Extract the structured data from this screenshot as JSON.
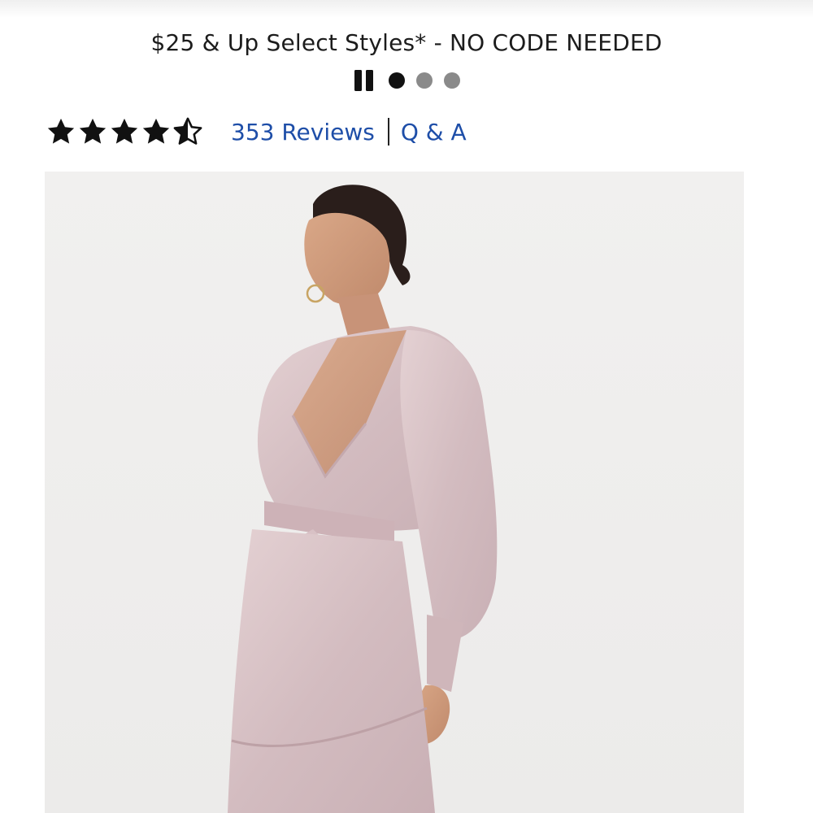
{
  "promo": {
    "text": "$25 & Up Select Styles* - NO CODE NEEDED"
  },
  "carousel": {
    "paused_icon": "pause-icon",
    "slides": [
      {
        "active": true
      },
      {
        "active": false
      },
      {
        "active": false
      }
    ]
  },
  "rating": {
    "value": 4.5,
    "max": 5,
    "reviews_label": "353 Reviews",
    "qa_label": "Q & A"
  },
  "product_image": {
    "subject": "model-wearing-satin-wrap-dress",
    "dress_color": "#d9c3c6"
  }
}
